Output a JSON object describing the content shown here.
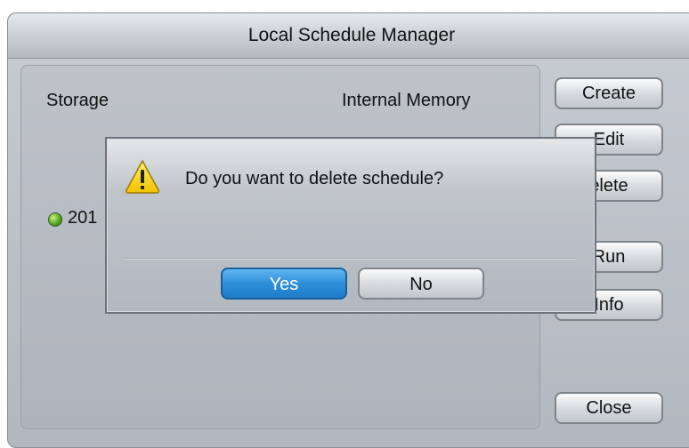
{
  "window": {
    "title": "Local Schedule Manager"
  },
  "panel": {
    "storage_label": "Storage",
    "storage_value": "Internal Memory",
    "schedule_item_text": "201"
  },
  "sidebar": {
    "create_label": "Create",
    "edit_label": "Edit",
    "delete_label": "elete",
    "run_label": "Run",
    "info_label": "Info",
    "close_label": "Close"
  },
  "dialog": {
    "icon": "warning-icon",
    "message": "Do you want to delete schedule?",
    "yes_label": "Yes",
    "no_label": "No",
    "accent": "#2f8fd9"
  }
}
